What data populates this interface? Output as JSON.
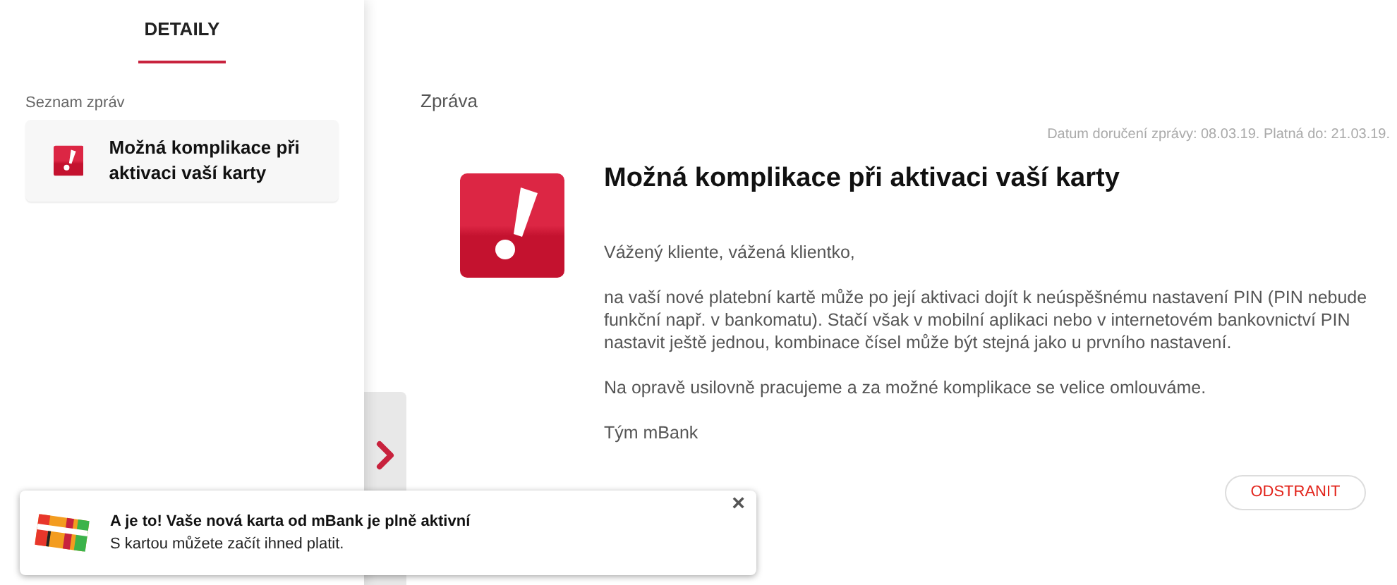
{
  "sidebar": {
    "tab": "DETAILY",
    "section_label": "Seznam zpráv",
    "messages": [
      {
        "title": "Možná komplikace při aktivaci vaší karty",
        "selected": true
      }
    ]
  },
  "message": {
    "section_label": "Zpráva",
    "meta": "Datum doručení zprávy: 08.03.19. Platná do: 21.03.19.",
    "title": "Možná komplikace při aktivaci vaší karty",
    "paragraphs": [
      "Vážený kliente, vážená klientko,",
      "na vaší nové platební kartě může po její aktivaci dojít k neúspěšnému nastavení PIN (PIN nebude funkční např. v bankomatu). Stačí však v mobilní aplikaci nebo v internetovém bankovnictví PIN nastavit ještě jednou, kombinace čísel může být stejná jako u prvního nastavení.",
      "Na opravě usilovně pracujeme a za možné komplikace se velice omlouváme.",
      "Tým mBank"
    ],
    "delete_button": "ODSTRANIT"
  },
  "toast": {
    "title": "A je to! Vaše nová karta od mBank je plně aktivní",
    "text": "S kartou můžete začít ihned platit.",
    "close": "×"
  }
}
